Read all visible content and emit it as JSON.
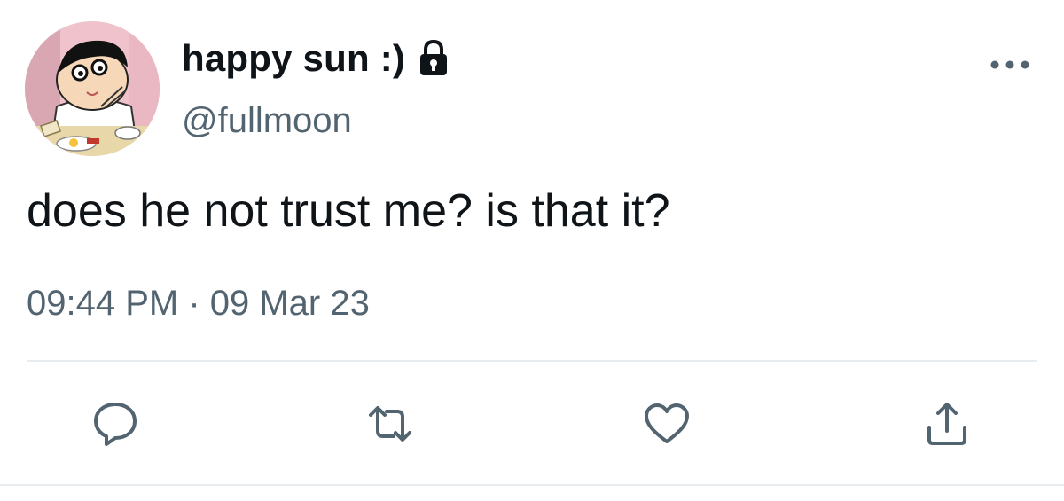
{
  "user": {
    "display_name": "happy sun :)",
    "handle": "@fullmoon",
    "protected_icon": "lock-icon",
    "avatar": "cartoon-avatar"
  },
  "tweet": {
    "text": "does he not trust me? is that it?",
    "timestamp": "09:44 PM · 09 Mar 23"
  },
  "actions": {
    "reply_icon": "comment-bubble-icon",
    "retweet_icon": "retweet-icon",
    "like_icon": "heart-icon",
    "share_icon": "share-upload-icon",
    "more_icon": "more-dots-icon"
  },
  "colors": {
    "primary_text": "#0f1419",
    "secondary_text": "#536471",
    "divider": "#e6ecf0"
  }
}
